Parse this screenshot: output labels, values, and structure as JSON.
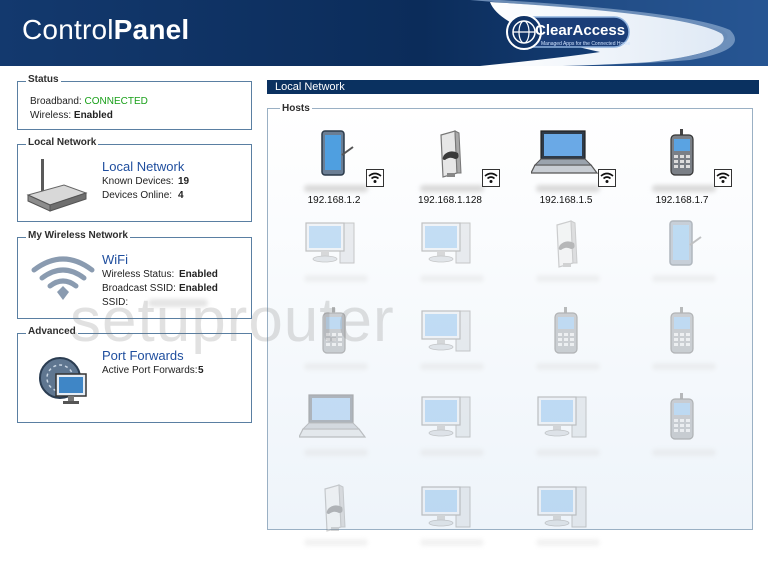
{
  "header": {
    "brand_regular": "Control",
    "brand_bold": "Panel",
    "logo_name": "ClearAccess",
    "logo_tagline": "Managed Apps for the Connected Home"
  },
  "status": {
    "title": "Status",
    "broadband_label": "Broadband:",
    "broadband_value": "CONNECTED",
    "wireless_label": "Wireless:",
    "wireless_value": "Enabled"
  },
  "local_network_box": {
    "title": "Local Network",
    "link": "Local Network",
    "known_label": "Known Devices:",
    "known_value": "19",
    "online_label": "Devices Online:",
    "online_value": "4"
  },
  "wireless_box": {
    "title": "My Wireless Network",
    "link": "WiFi",
    "status_label": "Wireless Status:",
    "status_value": "Enabled",
    "broadcast_label": "Broadcast SSID:",
    "broadcast_value": "Enabled",
    "ssid_label": "SSID:"
  },
  "advanced_box": {
    "title": "Advanced",
    "link": "Port Forwards",
    "active_label": "Active Port Forwards:",
    "active_value": "5"
  },
  "panel": {
    "header": "Local Network",
    "hosts_title": "Hosts",
    "hosts": [
      {
        "device": "tablet",
        "ip": "192.168.1.2",
        "online": true
      },
      {
        "device": "game-console",
        "ip": "192.168.1.128",
        "online": true
      },
      {
        "device": "laptop",
        "ip": "192.168.1.5",
        "online": true
      },
      {
        "device": "phone",
        "ip": "192.168.1.7",
        "online": true
      },
      {
        "device": "desktop",
        "online": false
      },
      {
        "device": "desktop",
        "online": false
      },
      {
        "device": "game-console",
        "online": false
      },
      {
        "device": "tablet",
        "online": false
      },
      {
        "device": "phone",
        "online": false
      },
      {
        "device": "desktop",
        "online": false
      },
      {
        "device": "phone",
        "online": false
      },
      {
        "device": "phone",
        "online": false
      },
      {
        "device": "laptop",
        "online": false
      },
      {
        "device": "desktop",
        "online": false
      },
      {
        "device": "desktop",
        "online": false
      },
      {
        "device": "phone",
        "online": false
      },
      {
        "device": "game-console",
        "online": false
      },
      {
        "device": "desktop",
        "online": false
      },
      {
        "device": "desktop",
        "online": false
      }
    ]
  },
  "watermark": "setuprouter",
  "colors": {
    "header_blue": "#0a3160",
    "link_blue": "#1f4e9e",
    "connected_green": "#1aa01a",
    "box_border": "#5a7fa2"
  }
}
